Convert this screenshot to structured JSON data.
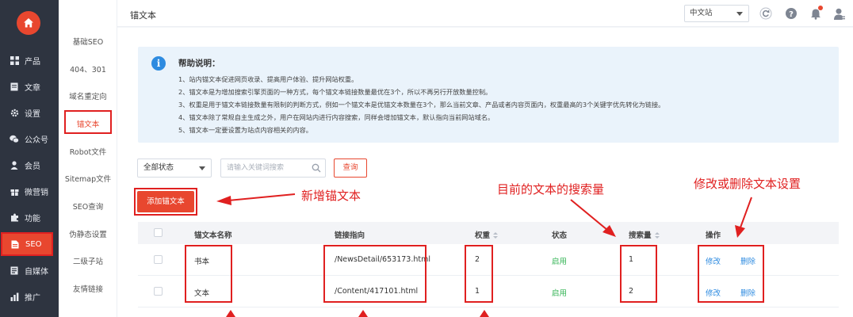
{
  "sidebar": {
    "items": [
      {
        "label": "产品",
        "icon": "grid-icon"
      },
      {
        "label": "文章",
        "icon": "document-icon"
      },
      {
        "label": "设置",
        "icon": "gear-icon"
      },
      {
        "label": "公众号",
        "icon": "wechat-icon"
      },
      {
        "label": "会员",
        "icon": "user-icon"
      },
      {
        "label": "微营销",
        "icon": "gift-icon"
      },
      {
        "label": "功能",
        "icon": "puzzle-icon"
      },
      {
        "label": "SEO",
        "icon": "seo-doc-icon",
        "active": true
      },
      {
        "label": "自媒体",
        "icon": "media-icon"
      },
      {
        "label": "推广",
        "icon": "chart-icon"
      }
    ]
  },
  "submenu": {
    "items": [
      "基础SEO",
      "404、301",
      "域名重定向",
      "锚文本",
      "Robot文件",
      "Sitemap文件",
      "SEO查询",
      "伪静态设置",
      "二级子站",
      "友情链接"
    ],
    "active": "锚文本"
  },
  "header": {
    "title": "锚文本",
    "language": "中文站"
  },
  "help": {
    "title": "帮助说明：",
    "lines": [
      "1、站内锚文本促进网页收录、提高用户体验、提升网站权重。",
      "2、锚文本是为增加搜索引擎页面的一种方式，每个锚文本链接数量最优在3个，所以不再另行开放数量控制。",
      "3、权重是用于锚文本链接数量有限制的判断方式，例如一个锚文本是优锚文本数量在3个，那么当前文章、产品或者内容页面内，权重最高的3个关键字优先转化为链接。",
      "4、锚文本除了常规自主生成之外，用户在网站内进行内容搜索，同样会增加锚文本，默认指向当前网站域名。",
      "5、锚文本一定要设置为站点内容相关的内容。"
    ]
  },
  "filters": {
    "status": "全部状态",
    "search_placeholder": "请输入关键词搜索",
    "query_label": "查询"
  },
  "add_button": "添加锚文本",
  "table": {
    "columns": [
      "锚文本名称",
      "链接指向",
      "权重",
      "状态",
      "搜索量",
      "操作"
    ],
    "rows": [
      {
        "name": "书本",
        "url": "/NewsDetail/653173.html",
        "weight": "2",
        "status": "启用",
        "searches": "1",
        "edit": "修改",
        "delete": "删除"
      },
      {
        "name": "文本",
        "url": "/Content/417101.html",
        "weight": "1",
        "status": "启用",
        "searches": "2",
        "edit": "修改",
        "delete": "删除"
      }
    ]
  },
  "annotations": {
    "add": "新增锚文本",
    "search_volume": "目前的文本的搜索量",
    "edit_delete": "修改或删除文本设置"
  },
  "colors": {
    "accent": "#e8472f",
    "annotation": "#e02020",
    "sidebar": "#2e3440",
    "link": "#2e8be0",
    "enabled": "#2fb250"
  }
}
